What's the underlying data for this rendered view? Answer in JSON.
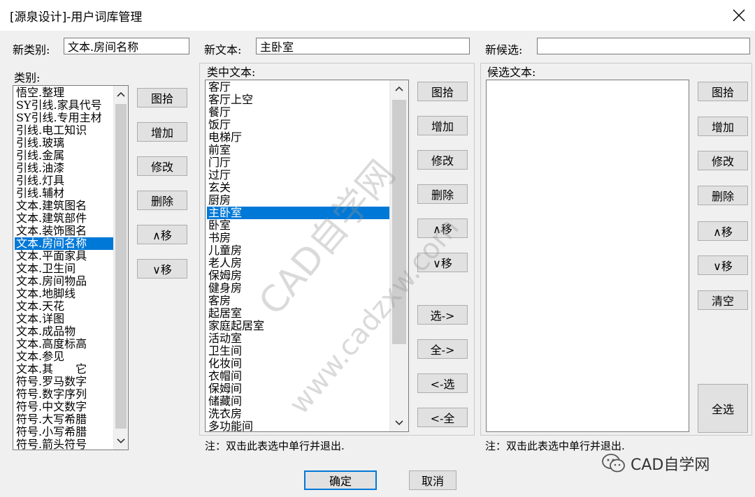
{
  "window": {
    "title": "[源泉设计]-用户词库管理"
  },
  "fields": {
    "new_category_label": "新类别:",
    "new_category_value": "文本.房间名称",
    "new_text_label": "新文本:",
    "new_text_value": "主卧室",
    "new_candidate_label": "新候选:",
    "new_candidate_value": ""
  },
  "category": {
    "label": "类别:",
    "selected_index": 13,
    "items": [
      "悟空.整理",
      "SY引线.家具代号",
      "SY引线.专用主材",
      "引线.电工知识",
      "引线.玻璃",
      "引线.金属",
      "引线.油漆",
      "引线.灯具",
      "引线.辅材",
      "文本.建筑图名",
      "文本.建筑部件",
      "文本.装饰图名",
      "文本.房间名称",
      "文本.平面家具",
      "文本.卫生间",
      "文本.房间物品",
      "文本.地脚线",
      "文本.天花",
      "文本.详图",
      "文本.成品物",
      "文本.高度标高",
      "文本.参见",
      "文本.其　　它",
      "符号.罗马数字",
      "符号.数字序列",
      "符号.中文数字",
      "符号.大写希腊",
      "符号.小写希腊",
      "符号.箭头符号"
    ],
    "buttons": {
      "pick": "图拾",
      "add": "增加",
      "edit": "修改",
      "delete": "删除",
      "up": "∧移",
      "down": "∨移"
    }
  },
  "texts": {
    "label": "类中文本:",
    "items": [
      "客厅",
      "客厅上空",
      "餐厅",
      "饭厅",
      "电梯厅",
      "前室",
      "门厅",
      "过厅",
      "玄关",
      "厨房",
      "主卧室",
      "卧室",
      "书房",
      "儿童房",
      "老人房",
      "保姆房",
      "健身房",
      "客房",
      "起居室",
      "家庭起居室",
      "活动室",
      "卫生间",
      "化妆间",
      "衣帽间",
      "保姆间",
      "储藏间",
      "洗衣房",
      "多功能间"
    ],
    "buttons": {
      "pick": "图拾",
      "add": "增加",
      "edit": "修改",
      "delete": "删除",
      "up": "∧移",
      "down": "∨移",
      "select_to": "选->",
      "all_to": "全->",
      "back_select": "<-选",
      "back_all": "<-全"
    },
    "note": "注：双击此表选中单行并退出."
  },
  "candidates": {
    "label": "候选文本:",
    "items": [],
    "buttons": {
      "pick": "图拾",
      "add": "增加",
      "edit": "修改",
      "delete": "删除",
      "up": "∧移",
      "down": "∨移",
      "clear": "清空",
      "select_all": "全选"
    },
    "note": "注：双击此表选中单行并退出."
  },
  "footer": {
    "ok": "确定",
    "cancel": "取消"
  },
  "watermark": {
    "line1": "CAD自学网",
    "line2": "www.cadzxw.com"
  },
  "brand": {
    "name": "CAD自学网",
    "icon": "wechat-icon"
  },
  "colors": {
    "selection": "#0078d7",
    "window_bg": "#f0f0f0"
  }
}
